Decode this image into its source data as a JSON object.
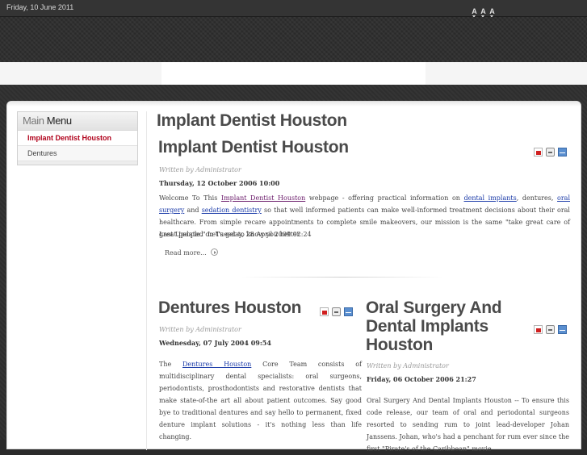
{
  "header": {
    "date": "Friday, 10 June 2011",
    "font_sizer": [
      "A",
      "A",
      "A"
    ]
  },
  "sidebar": {
    "title_part1": "Main",
    "title_part2": "Menu",
    "items": [
      {
        "label": "Implant Dentist Houston",
        "active": true
      },
      {
        "label": "Dentures",
        "active": false
      }
    ]
  },
  "main": {
    "component_heading": "Implant Dentist Houston",
    "articles": [
      {
        "title": "Implant Dentist Houston",
        "author": "Written by Administrator",
        "date": "Thursday, 12 October 2006 10:00",
        "body": {
          "t1": "Welcome To This ",
          "l1": "Implant Dentist Houston",
          "t2": " webpage - offering practical information on ",
          "l2": "dental implants",
          "t3": ", dentures, ",
          "l3": "oral surgery",
          "t4": " and ",
          "l4": "sedation dentistry",
          "t5": " so that well informed patients can make well-informed treatment decisions about their oral healthcare. From simple recare appointments to complete smile makeovers, our mission is the same \"take great care of great people.\" Let's get to know you better."
        },
        "last_updated": "Last Updated on Tuesday, 28 April 2009 02:24",
        "read_more": "Read more..."
      },
      {
        "title": "Dentures Houston",
        "author": "Written by Administrator",
        "date": "Wednesday, 07 July 2004 09:54",
        "body": {
          "t1": "The ",
          "l1": "Dentures Houston",
          "t2": " Core Team consists of multidisciplinary dental specialists: oral surgeons, periodontists, prosthodontists and restorative dentists that make state-of-the art all about patient outcomes. Say good bye to traditional dentures and say hello to permanent, fixed denture implant solutions - it's nothing less than life changing."
        }
      },
      {
        "title": "Oral Surgery And Dental Implants Houston",
        "title_lines": [
          "Oral Surgery And",
          "Dental Implants",
          "Houston"
        ],
        "author": "Written by Administrator",
        "date": "Friday, 06 October 2006 21:27",
        "body": {
          "t1": "Oral Surgery And Dental Implants Houston -- To ensure this code release, our team of oral and periodontal surgeons resorted to sending rum to joint lead-developer Johan Janssens. Johan, who's had a penchant for rum ever since the first \"Pirate's of the Caribbean\" movie"
        }
      }
    ]
  },
  "icons": {
    "pdf": "pdf-icon",
    "print": "print-icon",
    "email": "email-icon",
    "readmore": "arrow-circle-icon"
  }
}
